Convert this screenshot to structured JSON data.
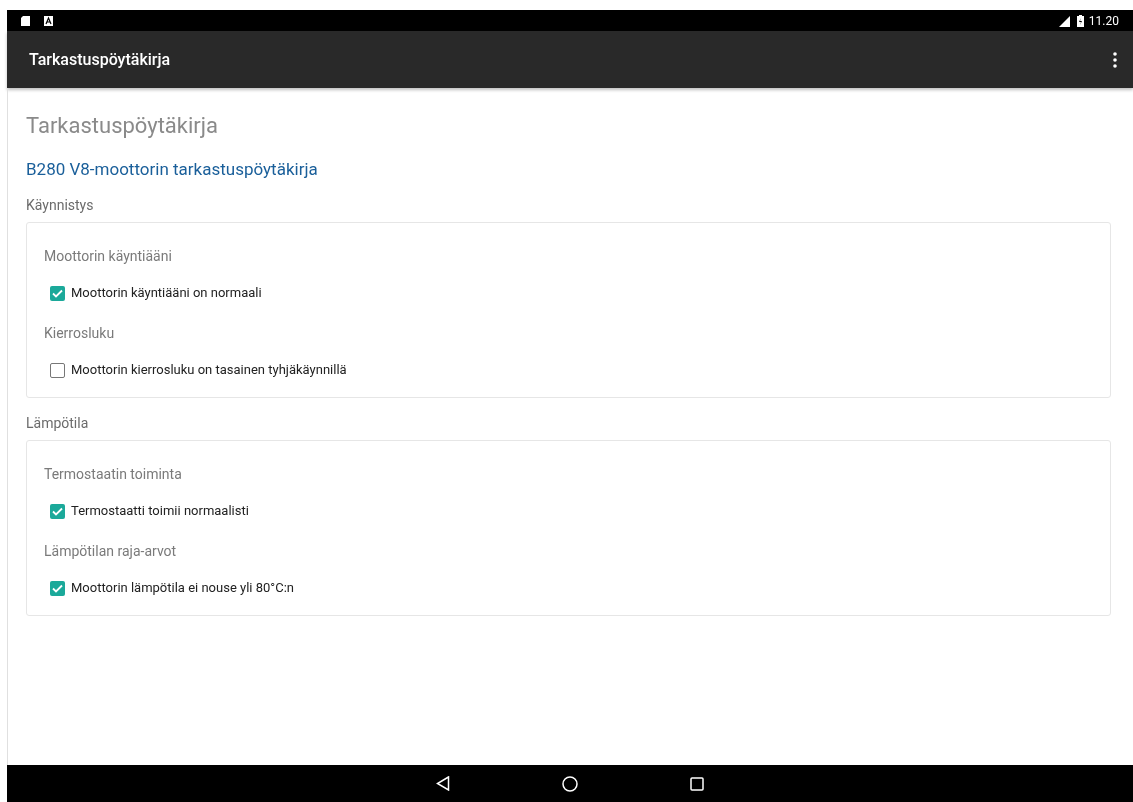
{
  "status_bar": {
    "time": "11.20"
  },
  "app_bar": {
    "title": "Tarkastuspöytäkirja"
  },
  "page": {
    "heading": "Tarkastuspöytäkirja",
    "subtitle": "B280 V8-moottorin tarkastuspöytäkirja"
  },
  "sections": [
    {
      "title": "Käynnistys",
      "groups": [
        {
          "label": "Moottorin käyntiääni",
          "items": [
            {
              "label": "Moottorin käyntiääni on normaali",
              "checked": true
            }
          ]
        },
        {
          "label": "Kierrosluku",
          "items": [
            {
              "label": "Moottorin kierrosluku on tasainen tyhjäkäynnillä",
              "checked": false
            }
          ]
        }
      ]
    },
    {
      "title": "Lämpötila",
      "groups": [
        {
          "label": "Termostaatin toiminta",
          "items": [
            {
              "label": "Termostaatti toimii normaalisti",
              "checked": true
            }
          ]
        },
        {
          "label": "Lämpötilan raja-arvot",
          "items": [
            {
              "label": "Moottorin lämpötila ei nouse yli 80°C:n",
              "checked": true
            }
          ]
        }
      ]
    }
  ]
}
